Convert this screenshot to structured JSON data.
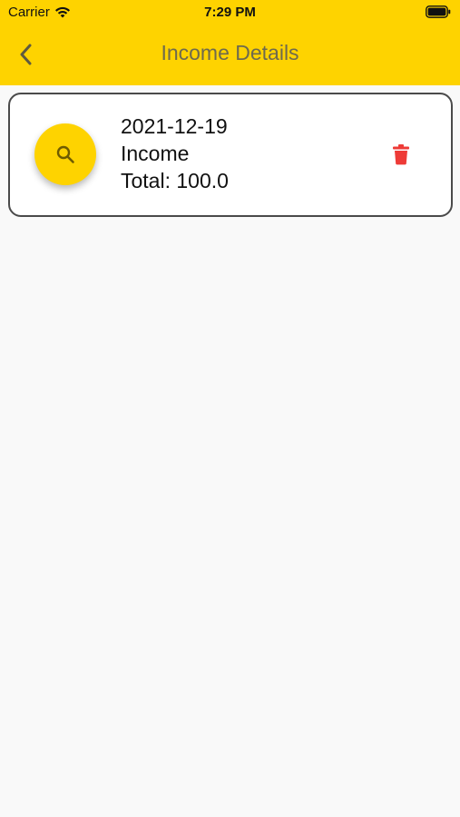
{
  "status_bar": {
    "carrier": "Carrier",
    "time": "7:29 PM"
  },
  "header": {
    "title": "Income Details",
    "back_icon": "chevron-left-icon",
    "background_color": "#fed300",
    "title_color": "#6e6a4e"
  },
  "records": [
    {
      "date": "2021-12-19",
      "type": "Income",
      "total": "Total: 100.0",
      "action_icon": "search-icon",
      "delete_icon": "trash-icon",
      "delete_color": "#ee3b37"
    }
  ]
}
